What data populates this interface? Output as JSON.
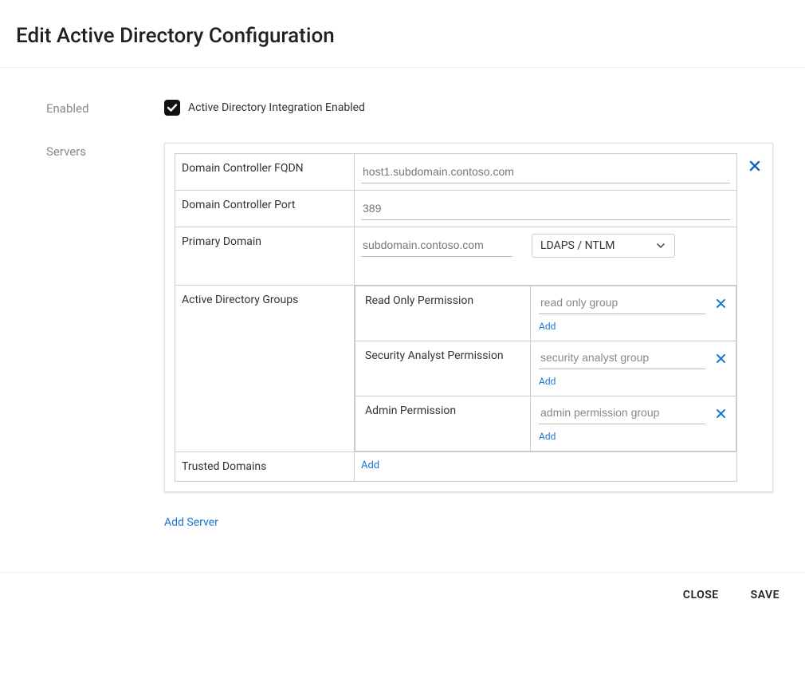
{
  "title": "Edit Active Directory Configuration",
  "labels": {
    "enabled": "Enabled",
    "servers": "Servers"
  },
  "checkbox": {
    "label": "Active Directory Integration Enabled",
    "checked": true
  },
  "server": {
    "fqdn": {
      "label": "Domain Controller FQDN",
      "placeholder": "host1.subdomain.contoso.com",
      "value": ""
    },
    "port": {
      "label": "Domain Controller Port",
      "placeholder": "389",
      "value": ""
    },
    "primary_domain": {
      "label": "Primary Domain",
      "placeholder": "subdomain.contoso.com",
      "value": ""
    },
    "auth_method": {
      "selected": "LDAPS / NTLM"
    },
    "groups_label": "Active Directory Groups",
    "groups": {
      "read_only": {
        "perm": "Read Only Permission",
        "placeholder": "read only group"
      },
      "security": {
        "perm": "Security Analyst Permission",
        "placeholder": "security analyst group"
      },
      "admin": {
        "perm": "Admin Permission",
        "placeholder": "admin permission group"
      }
    },
    "trusted_domains": {
      "label": "Trusted Domains"
    }
  },
  "links": {
    "add": "Add",
    "add_server": "Add Server"
  },
  "footer": {
    "close": "CLOSE",
    "save": "SAVE"
  }
}
